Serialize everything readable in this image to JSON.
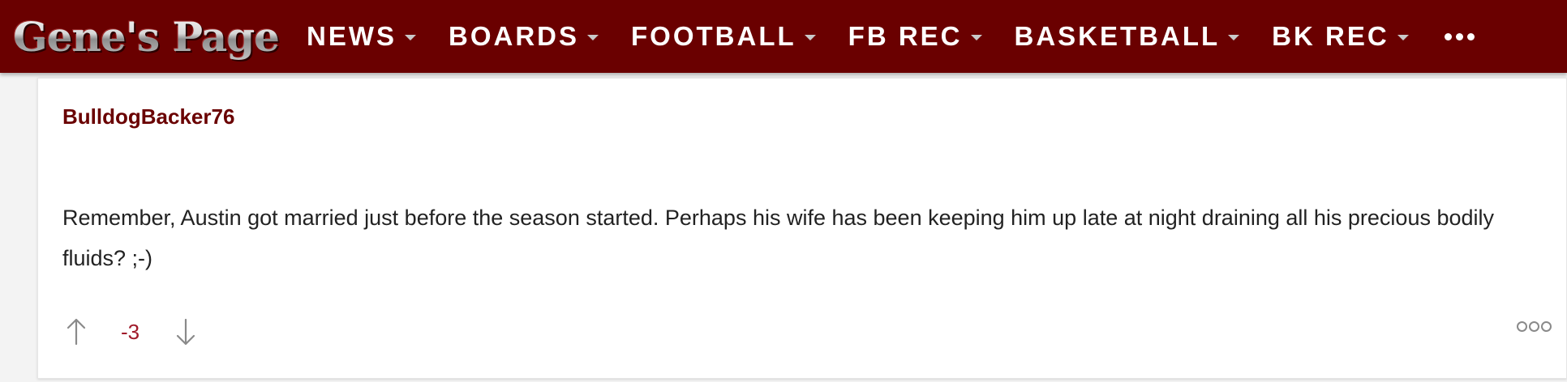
{
  "site": {
    "logo_text": "Gene's Page"
  },
  "nav": {
    "items": [
      {
        "label": "NEWS"
      },
      {
        "label": "BOARDS"
      },
      {
        "label": "FOOTBALL"
      },
      {
        "label": "FB REC"
      },
      {
        "label": "BASKETBALL"
      },
      {
        "label": "BK REC"
      }
    ],
    "more_icon": "ellipsis-icon"
  },
  "post": {
    "author": "BulldogBacker76",
    "body": "Remember, Austin got married just before the season started. Perhaps his wife has been keeping him up late at night draining all his precious bodily fluids? ;-)",
    "vote_count": "-3",
    "upvote_icon": "arrow-up-icon",
    "downvote_icon": "arrow-down-icon",
    "options_icon": "more-options-icon"
  },
  "colors": {
    "brand": "#6a0000",
    "vote_count": "#a01a2a",
    "icon_grey": "#8a8a8a"
  }
}
